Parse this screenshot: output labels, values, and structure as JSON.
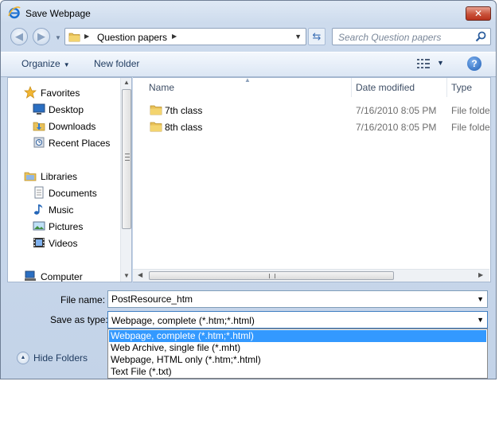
{
  "window": {
    "title": "Save Webpage",
    "close_label": "✕"
  },
  "address": {
    "path": [
      "Question papers"
    ]
  },
  "search": {
    "placeholder": "Search Question papers"
  },
  "toolbar": {
    "organize_label": "Organize",
    "new_folder_label": "New folder"
  },
  "nav": {
    "items": [
      {
        "label": "Favorites",
        "icon": "star-icon"
      },
      {
        "label": "Desktop",
        "icon": "desktop-icon"
      },
      {
        "label": "Downloads",
        "icon": "downloads-icon"
      },
      {
        "label": "Recent Places",
        "icon": "recent-places-icon"
      },
      {
        "label": "Libraries",
        "icon": "libraries-icon"
      },
      {
        "label": "Documents",
        "icon": "documents-icon"
      },
      {
        "label": "Music",
        "icon": "music-icon"
      },
      {
        "label": "Pictures",
        "icon": "pictures-icon"
      },
      {
        "label": "Videos",
        "icon": "videos-icon"
      },
      {
        "label": "Computer",
        "icon": "computer-icon"
      }
    ]
  },
  "files": {
    "columns": {
      "name": "Name",
      "date": "Date modified",
      "type": "Type"
    },
    "rows": [
      {
        "name": "7th class",
        "date": "7/16/2010 8:05 PM",
        "type": "File folder"
      },
      {
        "name": "8th class",
        "date": "7/16/2010 8:05 PM",
        "type": "File folder"
      }
    ]
  },
  "form": {
    "filename_label": "File name:",
    "filename_value": "PostResource_htm",
    "savetype_label": "Save as type:",
    "savetype_value": "Webpage, complete (*.htm;*.html)",
    "savetype_options": [
      "Webpage, complete (*.htm;*.html)",
      "Web Archive, single file (*.mht)",
      "Webpage, HTML only (*.htm;*.html)",
      "Text File (*.txt)"
    ]
  },
  "footer": {
    "hide_folders_label": "Hide Folders"
  },
  "colors": {
    "accent": "#3399ff",
    "title_bg": "#cddbed",
    "close_red": "#c9523a"
  }
}
